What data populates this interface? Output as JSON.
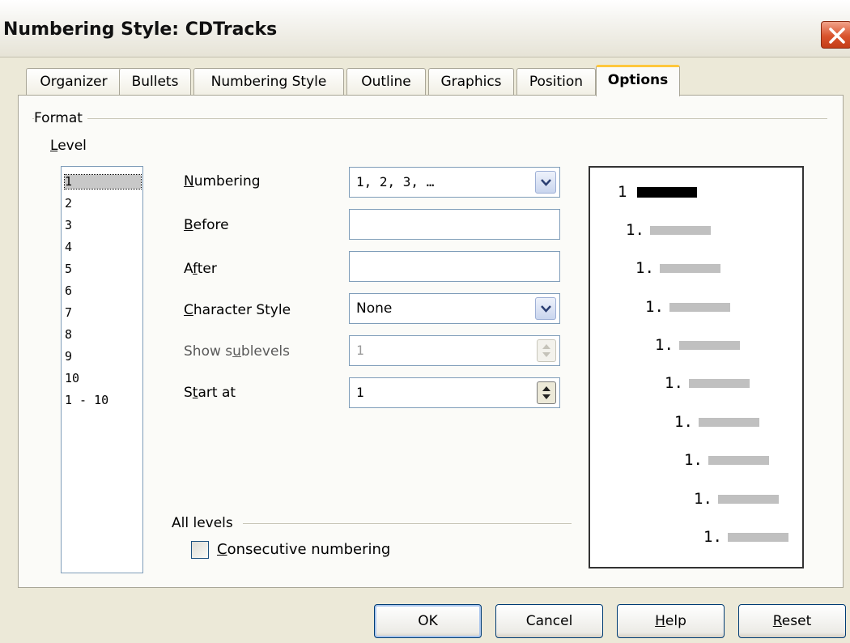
{
  "window": {
    "title": "Numbering Style: CDTracks"
  },
  "tabs": [
    {
      "label": "Organizer"
    },
    {
      "label": "Bullets"
    },
    {
      "label": "Numbering Style"
    },
    {
      "label": "Outline"
    },
    {
      "label": "Graphics"
    },
    {
      "label": "Position"
    },
    {
      "label": "Options",
      "active": true
    }
  ],
  "format": {
    "group_label": "Format",
    "level_label": "Level",
    "levels": [
      "1",
      "2",
      "3",
      "4",
      "5",
      "6",
      "7",
      "8",
      "9",
      "10",
      "1 - 10"
    ],
    "selected_level": "1",
    "numbering": {
      "label": "Numbering",
      "value": "1, 2, 3, …"
    },
    "before": {
      "label": "Before",
      "value": ""
    },
    "after": {
      "label": "After",
      "value": ""
    },
    "character_style": {
      "label": "Character Style",
      "value": "None"
    },
    "show_sublevels": {
      "label": "Show sublevels",
      "value": "1",
      "disabled": true
    },
    "start_at": {
      "label": "Start at",
      "value": "1"
    }
  },
  "all_levels": {
    "group_label": "All levels",
    "consecutive_numbering": {
      "label": "Consecutive numbering",
      "checked": false
    }
  },
  "preview": {
    "first": "1",
    "rows": [
      "1.",
      "1.",
      "1.",
      "1.",
      "1.",
      "1.",
      "1.",
      "1.",
      "1."
    ]
  },
  "buttons": {
    "ok": "OK",
    "cancel": "Cancel",
    "help": "Help",
    "reset": "Reset"
  },
  "colors": {
    "tab_highlight": "#ffc73c",
    "close_button": "#d9532c",
    "preview_bar": "#c0c0c0"
  }
}
